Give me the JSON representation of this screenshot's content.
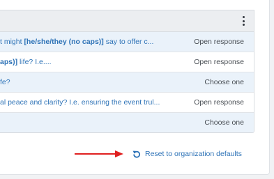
{
  "table": {
    "menu_icon": "kebab-vertical-icon",
    "rows": [
      {
        "pre": "t might ",
        "bold": "[he/she/they (no caps)]",
        "post": " say to offer c...",
        "type": "Open response"
      },
      {
        "pre": "",
        "bold": "aps)]",
        "post": " life? I.e....",
        "type": "Open response"
      },
      {
        "pre": "fe?",
        "bold": "",
        "post": "",
        "type": "Choose one"
      },
      {
        "pre": "al peace and clarity? I.e. ensuring the event trul...",
        "bold": "",
        "post": "",
        "type": "Open response"
      },
      {
        "pre": "",
        "bold": "",
        "post": "",
        "type": "Choose one"
      }
    ]
  },
  "footer": {
    "reset_label": "Reset to organization defaults",
    "reset_icon": "undo-icon",
    "arrow_color": "#e02020"
  },
  "colors": {
    "link": "#2e73b7",
    "row_alt": "#eaf2fa",
    "header_bg": "#eceef1"
  }
}
